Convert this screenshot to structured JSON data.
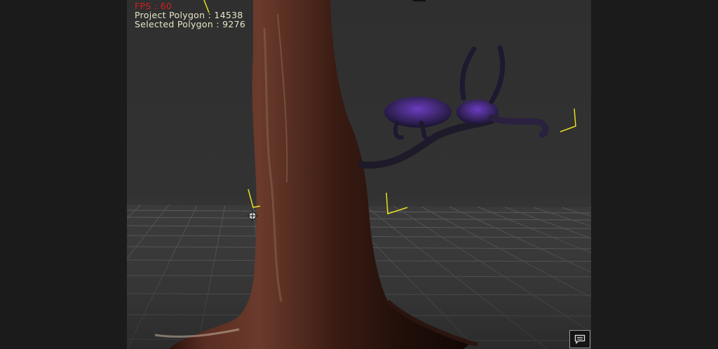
{
  "viewport": {
    "stats": {
      "fps": "FPS : 60",
      "project_polygon": "Project Polygon : 14538",
      "selected_polygon": "Selected Polygon : 9276"
    },
    "colors": {
      "fps_text": "#d41e1e",
      "stats_text": "#e6e6c8",
      "background": "#2f2f2f",
      "grid_lines": "#5a5a5a",
      "light_gizmo": "#e8e020",
      "tree_bark": "#3a1c14",
      "creature": "#3a2a6e"
    },
    "icons": {
      "chat": "speech-bubble-icon",
      "cursor": "move-cursor-icon",
      "gizmo": "light-gizmo-icon"
    }
  }
}
